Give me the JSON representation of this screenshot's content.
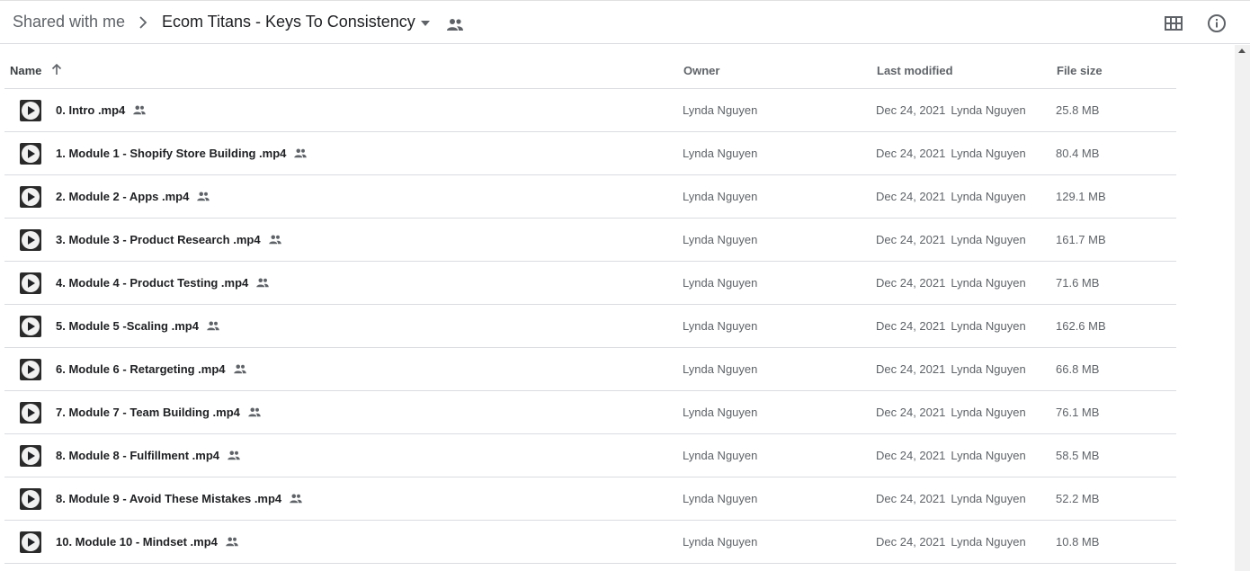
{
  "breadcrumb": {
    "root": "Shared with me",
    "current": "Ecom Titans - Keys To Consistency"
  },
  "icons": {
    "separator": "chevron-right-icon",
    "caret": "caret-down-icon",
    "shared": "people-icon",
    "grid": "grid-view-icon",
    "info": "info-icon",
    "sort": "arrow-up-icon",
    "file": "video-play-icon"
  },
  "columns": {
    "name": "Name",
    "owner": "Owner",
    "last_modified": "Last modified",
    "file_size": "File size"
  },
  "files": [
    {
      "name": "0. Intro .mp4",
      "owner": "Lynda Nguyen",
      "modified": "Dec 24, 2021",
      "modified_by": "Lynda Nguyen",
      "size": "25.8 MB"
    },
    {
      "name": "1. Module 1 - Shopify Store Building .mp4",
      "owner": "Lynda Nguyen",
      "modified": "Dec 24, 2021",
      "modified_by": "Lynda Nguyen",
      "size": "80.4 MB"
    },
    {
      "name": "2. Module 2 - Apps .mp4",
      "owner": "Lynda Nguyen",
      "modified": "Dec 24, 2021",
      "modified_by": "Lynda Nguyen",
      "size": "129.1 MB"
    },
    {
      "name": "3. Module 3 - Product Research .mp4",
      "owner": "Lynda Nguyen",
      "modified": "Dec 24, 2021",
      "modified_by": "Lynda Nguyen",
      "size": "161.7 MB"
    },
    {
      "name": "4. Module 4 - Product Testing .mp4",
      "owner": "Lynda Nguyen",
      "modified": "Dec 24, 2021",
      "modified_by": "Lynda Nguyen",
      "size": "71.6 MB"
    },
    {
      "name": "5. Module 5 -Scaling .mp4",
      "owner": "Lynda Nguyen",
      "modified": "Dec 24, 2021",
      "modified_by": "Lynda Nguyen",
      "size": "162.6 MB"
    },
    {
      "name": "6. Module 6 - Retargeting .mp4",
      "owner": "Lynda Nguyen",
      "modified": "Dec 24, 2021",
      "modified_by": "Lynda Nguyen",
      "size": "66.8 MB"
    },
    {
      "name": "7. Module 7 - Team Building .mp4",
      "owner": "Lynda Nguyen",
      "modified": "Dec 24, 2021",
      "modified_by": "Lynda Nguyen",
      "size": "76.1 MB"
    },
    {
      "name": "8. Module 8 - Fulfillment .mp4",
      "owner": "Lynda Nguyen",
      "modified": "Dec 24, 2021",
      "modified_by": "Lynda Nguyen",
      "size": "58.5 MB"
    },
    {
      "name": "8. Module 9 - Avoid These Mistakes .mp4",
      "owner": "Lynda Nguyen",
      "modified": "Dec 24, 2021",
      "modified_by": "Lynda Nguyen",
      "size": "52.2 MB"
    },
    {
      "name": "10. Module 10 - Mindset .mp4",
      "owner": "Lynda Nguyen",
      "modified": "Dec 24, 2021",
      "modified_by": "Lynda Nguyen",
      "size": "10.8 MB"
    }
  ]
}
